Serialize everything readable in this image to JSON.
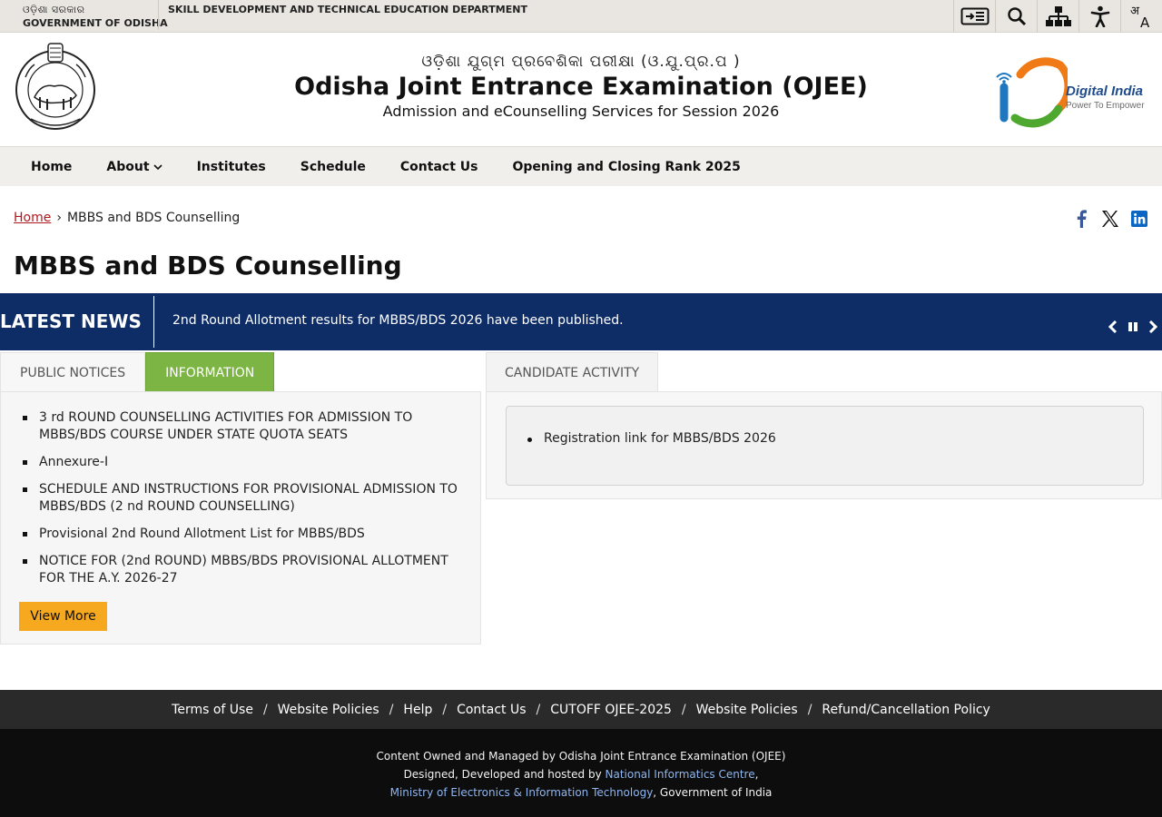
{
  "topbar": {
    "gov_odia": "ଓଡ଼ିଶା ସରକାର",
    "gov_english": "GOVERNMENT OF ODISHA",
    "department": "SKILL DEVELOPMENT AND TECHNICAL EDUCATION DEPARTMENT",
    "tools": [
      "skip-to-content-icon",
      "search-icon",
      "sitemap-icon",
      "accessibility-icon",
      "language-icon"
    ]
  },
  "header": {
    "odia_title": "ଓଡ଼ିଶା ଯୁଗ୍ମ ପ୍ରବେଶିକା ପରୀକ୍ଷା (ଓ.ଯୁ.ପ୍ର.ପ )",
    "title": "Odisha Joint Entrance Examination (OJEE)",
    "subtitle": "Admission and eCounselling Services for Session 2026",
    "digital_india_title": "Digital India",
    "digital_india_tagline": "Power To Empower"
  },
  "nav": {
    "items": [
      {
        "label": "Home"
      },
      {
        "label": "About"
      },
      {
        "label": "Institutes"
      },
      {
        "label": "Schedule"
      },
      {
        "label": "Contact Us"
      },
      {
        "label": "Opening and Closing Rank 2025"
      }
    ]
  },
  "breadcrumb": {
    "home": "Home",
    "separator": "›",
    "current": "MBBS and BDS Counselling"
  },
  "page_title": "MBBS and BDS Counselling",
  "news": {
    "label": "LATEST NEWS",
    "text": "2nd Round Allotment results for MBBS/BDS 2026 have been published."
  },
  "left_panel": {
    "tabs": [
      {
        "label": "PUBLIC NOTICES",
        "active": false
      },
      {
        "label": "INFORMATION",
        "active": true
      }
    ],
    "items": [
      "3 rd ROUND COUNSELLING ACTIVITIES FOR ADMISSION TO MBBS/BDS COURSE UNDER STATE QUOTA SEATS",
      "Annexure-I",
      "SCHEDULE AND INSTRUCTIONS FOR PROVISIONAL ADMISSION TO MBBS/BDS (2 nd ROUND COUNSELLING)",
      "Provisional 2nd Round Allotment List for MBBS/BDS",
      "NOTICE FOR (2nd ROUND) MBBS/BDS PROVISIONAL ALLOTMENT FOR THE A.Y. 2026-27"
    ],
    "view_more": "View More"
  },
  "right_panel": {
    "tab": "CANDIDATE ACTIVITY",
    "items": [
      "Registration link for MBBS/BDS 2026"
    ]
  },
  "footer": {
    "links": [
      "Terms of Use",
      "Website Policies",
      "Help",
      "Contact Us",
      "CUTOFF OJEE-2025",
      "Website Policies",
      "Refund/Cancellation Policy"
    ],
    "link_separator": "/",
    "line1": "Content Owned and Managed by Odisha Joint Entrance Examination (OJEE)",
    "line2_prefix": "Designed, Developed and hosted by ",
    "line2_link": "National Informatics Centre",
    "line2_suffix": ",",
    "line3_link": "Ministry of Electronics & Information Technology",
    "line3_suffix": ", Government of India"
  },
  "colors": {
    "news_bar": "#0e2c66",
    "active_tab": "#7db544",
    "view_more": "#f6a81f",
    "breadcrumb_link": "#b0181f",
    "footer_top": "#2a2a2a",
    "footer_bottom": "#0d0d0d"
  }
}
